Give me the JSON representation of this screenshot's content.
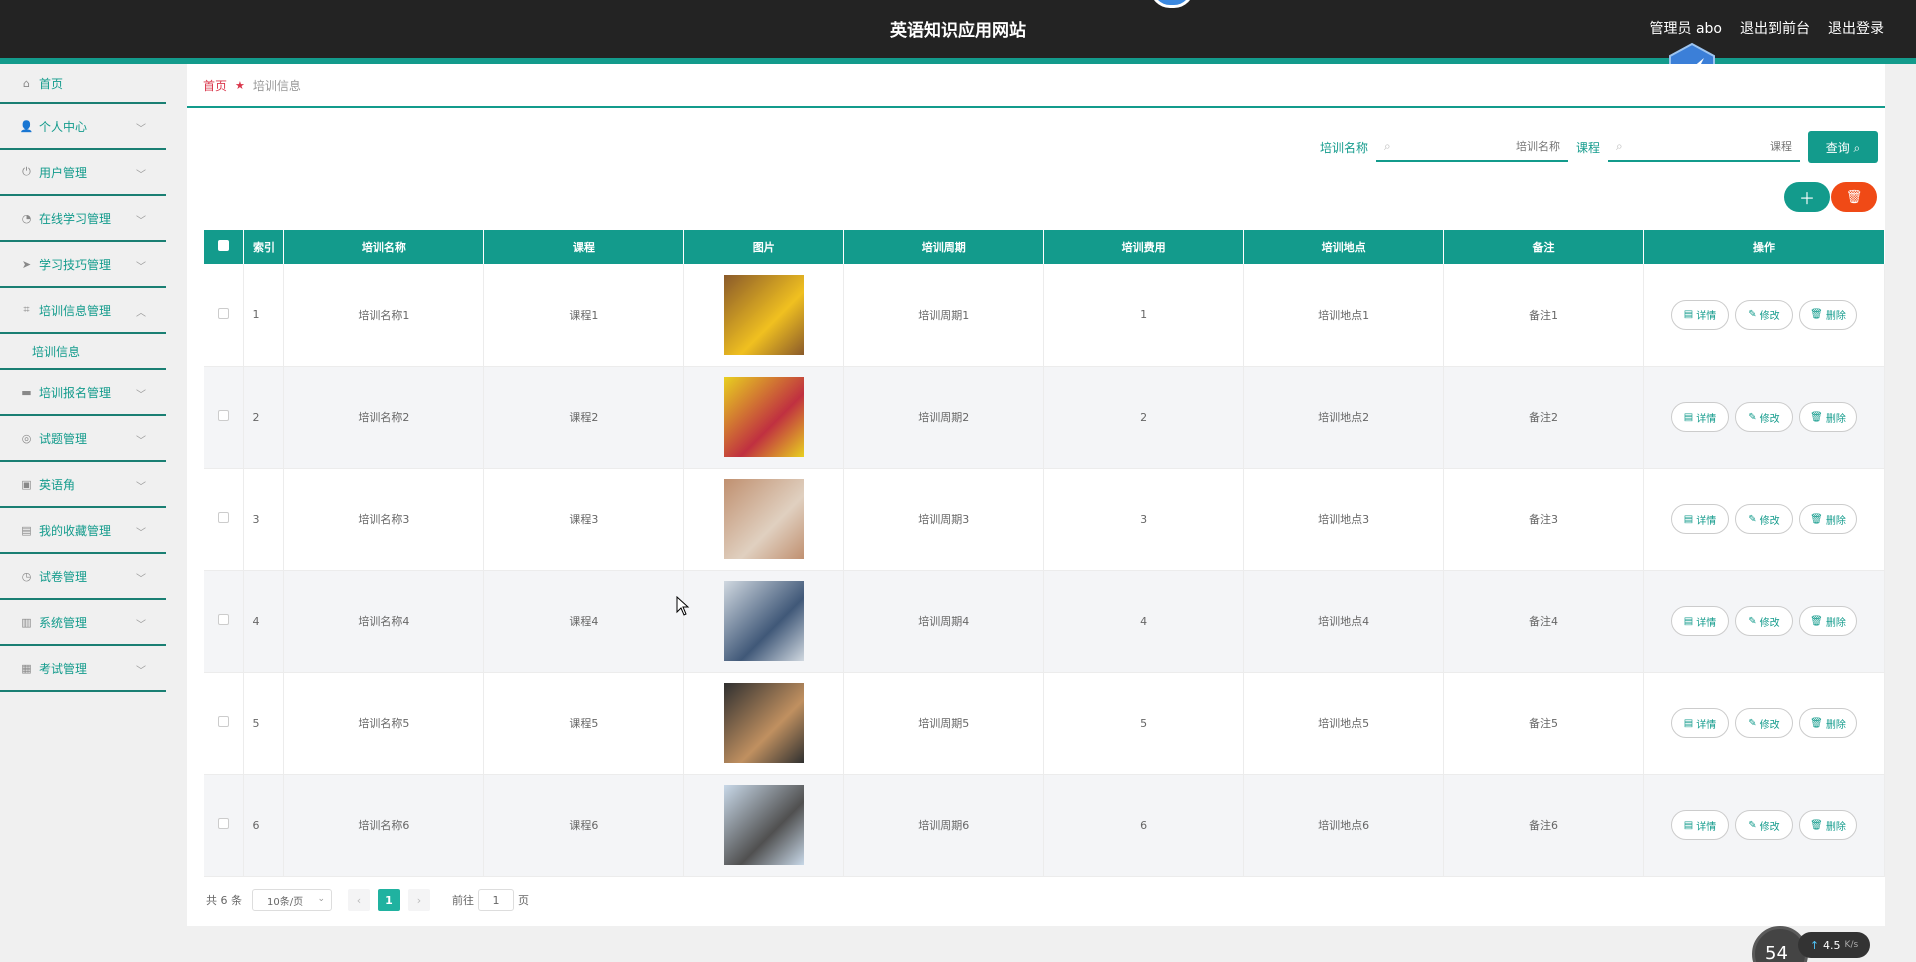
{
  "header": {
    "title": "英语知识应用网站",
    "admin": "管理员 abo",
    "back_front": "退出到前台",
    "logout": "退出登录"
  },
  "sidebar": {
    "items": [
      {
        "label": "首页",
        "icon": "home-icon"
      },
      {
        "label": "个人中心",
        "icon": "user-icon"
      },
      {
        "label": "用户管理",
        "icon": "power-icon"
      },
      {
        "label": "在线学习管理",
        "icon": "gauge-icon"
      },
      {
        "label": "学习技巧管理",
        "icon": "send-icon"
      },
      {
        "label": "培训信息管理",
        "icon": "crop-icon"
      },
      {
        "label": "培训报名管理",
        "icon": "comment-icon"
      },
      {
        "label": "试题管理",
        "icon": "globe-icon"
      },
      {
        "label": "英语角",
        "icon": "briefcase-icon"
      },
      {
        "label": "我的收藏管理",
        "icon": "printer-icon"
      },
      {
        "label": "试卷管理",
        "icon": "clock-icon"
      },
      {
        "label": "系统管理",
        "icon": "clipboard-icon"
      },
      {
        "label": "考试管理",
        "icon": "clipboard-check-icon"
      }
    ],
    "sub_item": "培训信息"
  },
  "breadcrumb": {
    "home": "首页",
    "current": "培训信息"
  },
  "search": {
    "name_label": "培训名称",
    "name_placeholder": "培训名称",
    "course_label": "课程",
    "course_placeholder": "课程",
    "query_label": "查询"
  },
  "table": {
    "headers": [
      "索引",
      "培训名称",
      "课程",
      "图片",
      "培训周期",
      "培训费用",
      "培训地点",
      "备注",
      "操作"
    ],
    "rows": [
      {
        "index": "1",
        "name": "培训名称1",
        "course": "课程1",
        "period": "培训周期1",
        "fee": "1",
        "place": "培训地点1",
        "note": "备注1",
        "img_colors": [
          "#8a5a2a",
          "#f0c020"
        ]
      },
      {
        "index": "2",
        "name": "培训名称2",
        "course": "课程2",
        "period": "培训周期2",
        "fee": "2",
        "place": "培训地点2",
        "note": "备注2",
        "img_colors": [
          "#e8d020",
          "#c03040"
        ]
      },
      {
        "index": "3",
        "name": "培训名称3",
        "course": "课程3",
        "period": "培训周期3",
        "fee": "3",
        "place": "培训地点3",
        "note": "备注3",
        "img_colors": [
          "#c09070",
          "#e0d0c0"
        ]
      },
      {
        "index": "4",
        "name": "培训名称4",
        "course": "课程4",
        "period": "培训周期4",
        "fee": "4",
        "place": "培训地点4",
        "note": "备注4",
        "img_colors": [
          "#d0d8e0",
          "#405878"
        ]
      },
      {
        "index": "5",
        "name": "培训名称5",
        "course": "课程5",
        "period": "培训周期5",
        "fee": "5",
        "place": "培训地点5",
        "note": "备注5",
        "img_colors": [
          "#303030",
          "#c09060"
        ]
      },
      {
        "index": "6",
        "name": "培训名称6",
        "course": "课程6",
        "period": "培训周期6",
        "fee": "6",
        "place": "培训地点6",
        "note": "备注6",
        "img_colors": [
          "#c8d8e8",
          "#505050"
        ]
      }
    ],
    "actions": {
      "detail": "详情",
      "edit": "修改",
      "delete": "删除"
    }
  },
  "pagination": {
    "total": "共 6 条",
    "page_size": "10条/页",
    "current_page": "1",
    "goto_prefix": "前往",
    "goto_value": "1",
    "goto_suffix": "页"
  },
  "net_widget": {
    "percent": "54",
    "rate": "4.5",
    "unit": "K/s"
  },
  "colors": {
    "accent": "#139b8c",
    "danger": "#f04a16",
    "header_bg": "#232323"
  }
}
